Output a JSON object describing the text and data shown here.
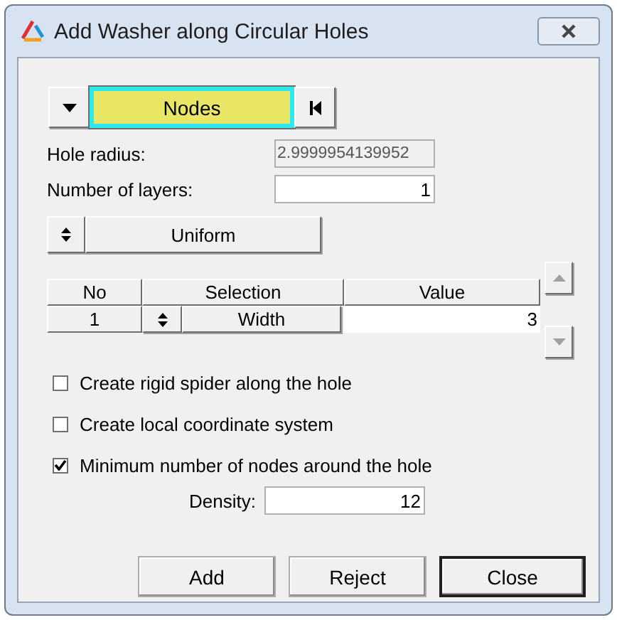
{
  "window": {
    "title": "Add Washer along Circular Holes"
  },
  "entity_selector": {
    "label": "Nodes",
    "active": true
  },
  "fields": [
    {
      "label": "Hole radius:",
      "value": "2.9999954139952",
      "disabled": true
    },
    {
      "label": "Number of layers:",
      "value": "1",
      "disabled": false
    }
  ],
  "mode": {
    "label": "Uniform"
  },
  "table": {
    "columns": [
      "No",
      "Selection",
      "Value"
    ],
    "rows": [
      {
        "no": "1",
        "selection": "Width",
        "value": "3"
      }
    ]
  },
  "options": [
    {
      "label": "Create rigid spider along the hole",
      "checked": false
    },
    {
      "label": "Create local coordinate system",
      "checked": false
    },
    {
      "label": "Minimum number of nodes around the hole",
      "checked": true
    }
  ],
  "density": {
    "label": "Density:",
    "value": "12"
  },
  "buttons": [
    {
      "label": "Add",
      "default": false
    },
    {
      "label": "Reject",
      "default": false
    },
    {
      "label": "Close",
      "default": true
    }
  ]
}
